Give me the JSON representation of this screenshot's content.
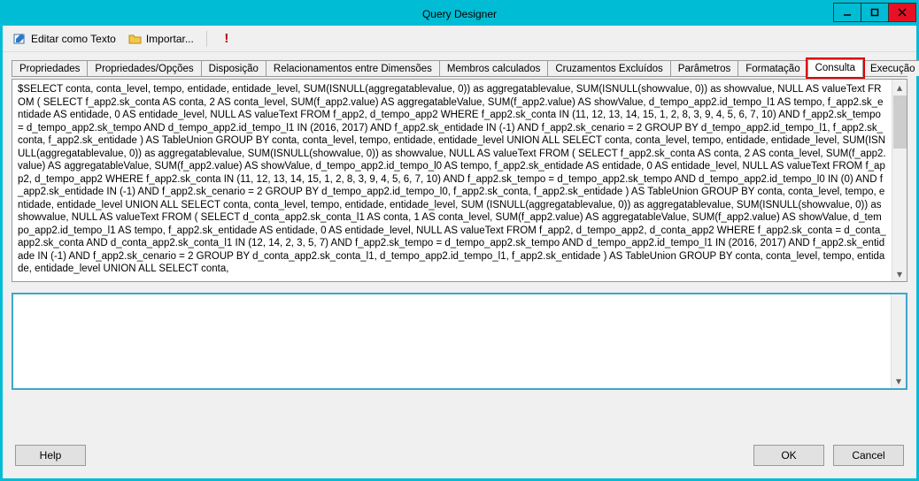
{
  "window": {
    "title": "Query Designer"
  },
  "toolbar": {
    "edit_as_text": "Editar como Texto",
    "import": "Importar..."
  },
  "tabs": [
    {
      "label": "Propriedades"
    },
    {
      "label": "Propriedades/Opções"
    },
    {
      "label": "Disposição"
    },
    {
      "label": "Relacionamentos entre Dimensões"
    },
    {
      "label": "Membros calculados"
    },
    {
      "label": "Cruzamentos Excluídos"
    },
    {
      "label": "Parâmetros"
    },
    {
      "label": "Formatação"
    },
    {
      "label": "Consulta"
    },
    {
      "label": "Execução"
    }
  ],
  "active_tab_index": 8,
  "sql": "$SELECT conta, conta_level, tempo, entidade, entidade_level, SUM(ISNULL(aggregatablevalue, 0)) as aggregatablevalue, SUM(ISNULL(showvalue, 0)) as showvalue, NULL AS valueText FROM ( SELECT f_app2.sk_conta AS conta, 2 AS conta_level, SUM(f_app2.value) AS aggregatableValue, SUM(f_app2.value) AS showValue, d_tempo_app2.id_tempo_l1 AS tempo, f_app2.sk_entidade AS entidade, 0 AS entidade_level, NULL AS valueText FROM f_app2, d_tempo_app2 WHERE  f_app2.sk_conta IN (11, 12, 13, 14, 15, 1, 2, 8, 3, 9, 4, 5, 6, 7, 10) AND f_app2.sk_tempo = d_tempo_app2.sk_tempo AND  d_tempo_app2.id_tempo_l1 IN (2016, 2017) AND  f_app2.sk_entidade IN (-1) AND f_app2.sk_cenario = 2 GROUP BY d_tempo_app2.id_tempo_l1, f_app2.sk_conta, f_app2.sk_entidade ) AS TableUnion GROUP BY conta, conta_level, tempo, entidade, entidade_level UNION ALL SELECT conta, conta_level, tempo, entidade, entidade_level, SUM(ISNULL(aggregatablevalue, 0)) as aggregatablevalue, SUM(ISNULL(showvalue, 0)) as showvalue, NULL AS valueText FROM ( SELECT f_app2.sk_conta AS conta, 2 AS conta_level, SUM(f_app2.value) AS aggregatableValue, SUM(f_app2.value) AS showValue, d_tempo_app2.id_tempo_l0 AS tempo, f_app2.sk_entidade AS entidade, 0 AS entidade_level, NULL AS valueText FROM f_app2, d_tempo_app2 WHERE  f_app2.sk_conta IN (11, 12, 13, 14, 15, 1, 2, 8, 3, 9, 4, 5, 6, 7, 10) AND f_app2.sk_tempo = d_tempo_app2.sk_tempo AND  d_tempo_app2.id_tempo_l0 IN (0) AND  f_app2.sk_entidade IN (-1) AND f_app2.sk_cenario = 2 GROUP BY d_tempo_app2.id_tempo_l0, f_app2.sk_conta, f_app2.sk_entidade ) AS TableUnion GROUP BY conta, conta_level, tempo, entidade, entidade_level UNION ALL SELECT conta, conta_level, tempo, entidade, entidade_level, SUM (ISNULL(aggregatablevalue, 0)) as aggregatablevalue, SUM(ISNULL(showvalue, 0)) as showvalue, NULL AS valueText FROM ( SELECT d_conta_app2.sk_conta_l1 AS conta, 1 AS conta_level, SUM(f_app2.value) AS aggregatableValue, SUM(f_app2.value) AS showValue, d_tempo_app2.id_tempo_l1 AS tempo, f_app2.sk_entidade AS entidade, 0 AS entidade_level, NULL AS valueText FROM f_app2, d_tempo_app2, d_conta_app2 WHERE f_app2.sk_conta = d_conta_app2.sk_conta AND  d_conta_app2.sk_conta_l1 IN (12, 14, 2, 3, 5, 7) AND f_app2.sk_tempo = d_tempo_app2.sk_tempo AND  d_tempo_app2.id_tempo_l1 IN (2016, 2017) AND  f_app2.sk_entidade IN (-1) AND f_app2.sk_cenario = 2 GROUP BY d_conta_app2.sk_conta_l1, d_tempo_app2.id_tempo_l1, f_app2.sk_entidade ) AS TableUnion GROUP BY conta, conta_level, tempo, entidade, entidade_level UNION ALL SELECT conta,",
  "footer": {
    "help": "Help",
    "ok": "OK",
    "cancel": "Cancel"
  }
}
